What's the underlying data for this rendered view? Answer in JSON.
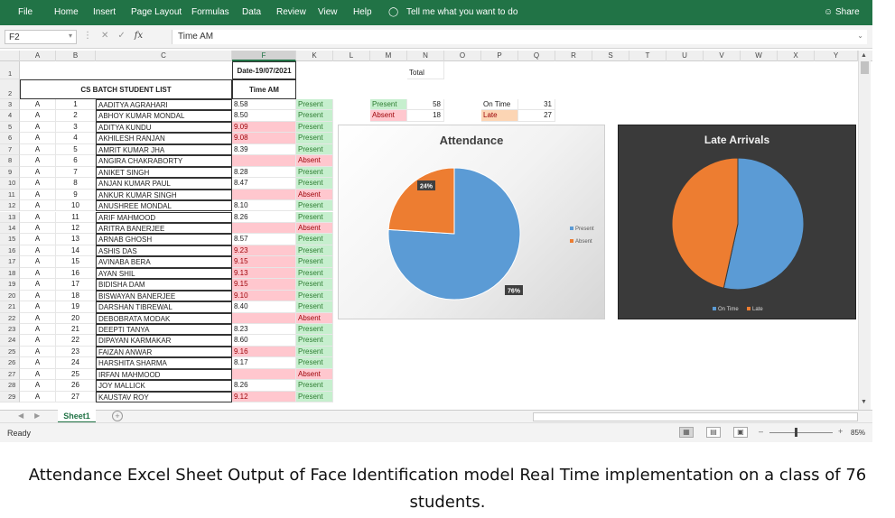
{
  "ribbon": {
    "tabs": [
      "File",
      "Home",
      "Insert",
      "Page Layout",
      "Formulas",
      "Data",
      "Review",
      "View",
      "Help"
    ],
    "tell_me": "Tell me what you want to do",
    "share": "Share"
  },
  "formula_bar": {
    "name_box": "F2",
    "fx": "fx",
    "content": "Time AM"
  },
  "columns": [
    "A",
    "B",
    "C",
    "F",
    "K",
    "L",
    "M",
    "N",
    "O",
    "P",
    "Q",
    "R",
    "S",
    "T",
    "U",
    "V",
    "W",
    "X",
    "Y"
  ],
  "header": {
    "date": "Date-19/07/2021",
    "time": "Time AM",
    "title": "CS BATCH STUDENT LIST",
    "total": "Total"
  },
  "summary": {
    "present_label": "Present",
    "present_count": "58",
    "absent_label": "Absent",
    "absent_count": "18",
    "ontime_label": "On Time",
    "ontime_count": "31",
    "late_label": "Late",
    "late_count": "27"
  },
  "rows": [
    {
      "n": "3",
      "sec": "A",
      "id": "1",
      "name": "AADITYA AGRAHARI",
      "time": "8.58",
      "status": "Present",
      "tclass": ""
    },
    {
      "n": "4",
      "sec": "A",
      "id": "2",
      "name": "ABHOY KUMAR MONDAL",
      "time": "8.50",
      "status": "Present",
      "tclass": ""
    },
    {
      "n": "5",
      "sec": "A",
      "id": "3",
      "name": "ADITYA KUNDU",
      "time": "9.09",
      "status": "Present",
      "tclass": "pink"
    },
    {
      "n": "6",
      "sec": "A",
      "id": "4",
      "name": "AKHILESH RANJAN",
      "time": "9.08",
      "status": "Present",
      "tclass": "pink"
    },
    {
      "n": "7",
      "sec": "A",
      "id": "5",
      "name": "AMRIT KUMAR JHA",
      "time": "8.39",
      "status": "Present",
      "tclass": ""
    },
    {
      "n": "8",
      "sec": "A",
      "id": "6",
      "name": "ANGIRA CHAKRABORTY",
      "time": "",
      "status": "Absent",
      "tclass": "pink"
    },
    {
      "n": "9",
      "sec": "A",
      "id": "7",
      "name": "ANIKET SINGH",
      "time": "8.28",
      "status": "Present",
      "tclass": ""
    },
    {
      "n": "10",
      "sec": "A",
      "id": "8",
      "name": "ANJAN KUMAR PAUL",
      "time": "8.47",
      "status": "Present",
      "tclass": ""
    },
    {
      "n": "11",
      "sec": "A",
      "id": "9",
      "name": "ANKUR KUMAR SINGH",
      "time": "",
      "status": "Absent",
      "tclass": "pink"
    },
    {
      "n": "12",
      "sec": "A",
      "id": "10",
      "name": "ANUSHREE MONDAL",
      "time": "8.10",
      "status": "Present",
      "tclass": ""
    },
    {
      "n": "13",
      "sec": "A",
      "id": "11",
      "name": "ARIF MAHMOOD",
      "time": "8.26",
      "status": "Present",
      "tclass": ""
    },
    {
      "n": "14",
      "sec": "A",
      "id": "12",
      "name": "ARITRA BANERJEE",
      "time": "",
      "status": "Absent",
      "tclass": "pink"
    },
    {
      "n": "15",
      "sec": "A",
      "id": "13",
      "name": "ARNAB GHOSH",
      "time": "8.57",
      "status": "Present",
      "tclass": ""
    },
    {
      "n": "16",
      "sec": "A",
      "id": "14",
      "name": "ASHIS DAS",
      "time": "9.23",
      "status": "Present",
      "tclass": "pink"
    },
    {
      "n": "17",
      "sec": "A",
      "id": "15",
      "name": "AVINABA BERA",
      "time": "9.15",
      "status": "Present",
      "tclass": "pink"
    },
    {
      "n": "18",
      "sec": "A",
      "id": "16",
      "name": "AYAN SHIL",
      "time": "9.13",
      "status": "Present",
      "tclass": "pink"
    },
    {
      "n": "19",
      "sec": "A",
      "id": "17",
      "name": "BIDISHA DAM",
      "time": "9.15",
      "status": "Present",
      "tclass": "pink"
    },
    {
      "n": "20",
      "sec": "A",
      "id": "18",
      "name": "BISWAYAN BANERJEE",
      "time": "9.10",
      "status": "Present",
      "tclass": "pink"
    },
    {
      "n": "21",
      "sec": "A",
      "id": "19",
      "name": "DARSHAN TIBREWAL",
      "time": "8.40",
      "status": "Present",
      "tclass": ""
    },
    {
      "n": "22",
      "sec": "A",
      "id": "20",
      "name": "DEBOBRATA MODAK",
      "time": "",
      "status": "Absent",
      "tclass": "pink"
    },
    {
      "n": "23",
      "sec": "A",
      "id": "21",
      "name": "DEEPTI TANYA",
      "time": "8.23",
      "status": "Present",
      "tclass": ""
    },
    {
      "n": "24",
      "sec": "A",
      "id": "22",
      "name": "DIPAYAN KARMAKAR",
      "time": "8.60",
      "status": "Present",
      "tclass": ""
    },
    {
      "n": "25",
      "sec": "A",
      "id": "23",
      "name": "FAIZAN ANWAR",
      "time": "9.16",
      "status": "Present",
      "tclass": "pink"
    },
    {
      "n": "26",
      "sec": "A",
      "id": "24",
      "name": "HARSHITA SHARMA",
      "time": "8.17",
      "status": "Present",
      "tclass": ""
    },
    {
      "n": "27",
      "sec": "A",
      "id": "25",
      "name": "IRFAN MAHMOOD",
      "time": "",
      "status": "Absent",
      "tclass": "pink"
    },
    {
      "n": "28",
      "sec": "A",
      "id": "26",
      "name": "JOY MALLICK",
      "time": "8.26",
      "status": "Present",
      "tclass": ""
    },
    {
      "n": "29",
      "sec": "A",
      "id": "27",
      "name": "KAUSTAV ROY",
      "time": "9.12",
      "status": "Present",
      "tclass": "pink"
    }
  ],
  "sheet_tab": "Sheet1",
  "status_bar": {
    "ready": "Ready",
    "zoom": "85%"
  },
  "colors": {
    "excel_green": "#217346",
    "present_fill": "#c6efce",
    "absent_fill": "#ffc7ce",
    "pie_blue": "#5b9bd5",
    "pie_orange": "#ed7d31"
  },
  "chart_data": [
    {
      "type": "pie",
      "title": "Attendance",
      "categories": [
        "Present",
        "Absent"
      ],
      "values": [
        76,
        24
      ],
      "data_labels": [
        "76%",
        "24%"
      ],
      "legend": "right"
    },
    {
      "type": "pie",
      "title": "Late Arrivals",
      "categories": [
        "On Time",
        "Late"
      ],
      "values": [
        31,
        27
      ],
      "legend": "bottom"
    }
  ],
  "caption": "Attendance Excel Sheet Output of Face Identification model Real Time implementation on a class of  76 students."
}
